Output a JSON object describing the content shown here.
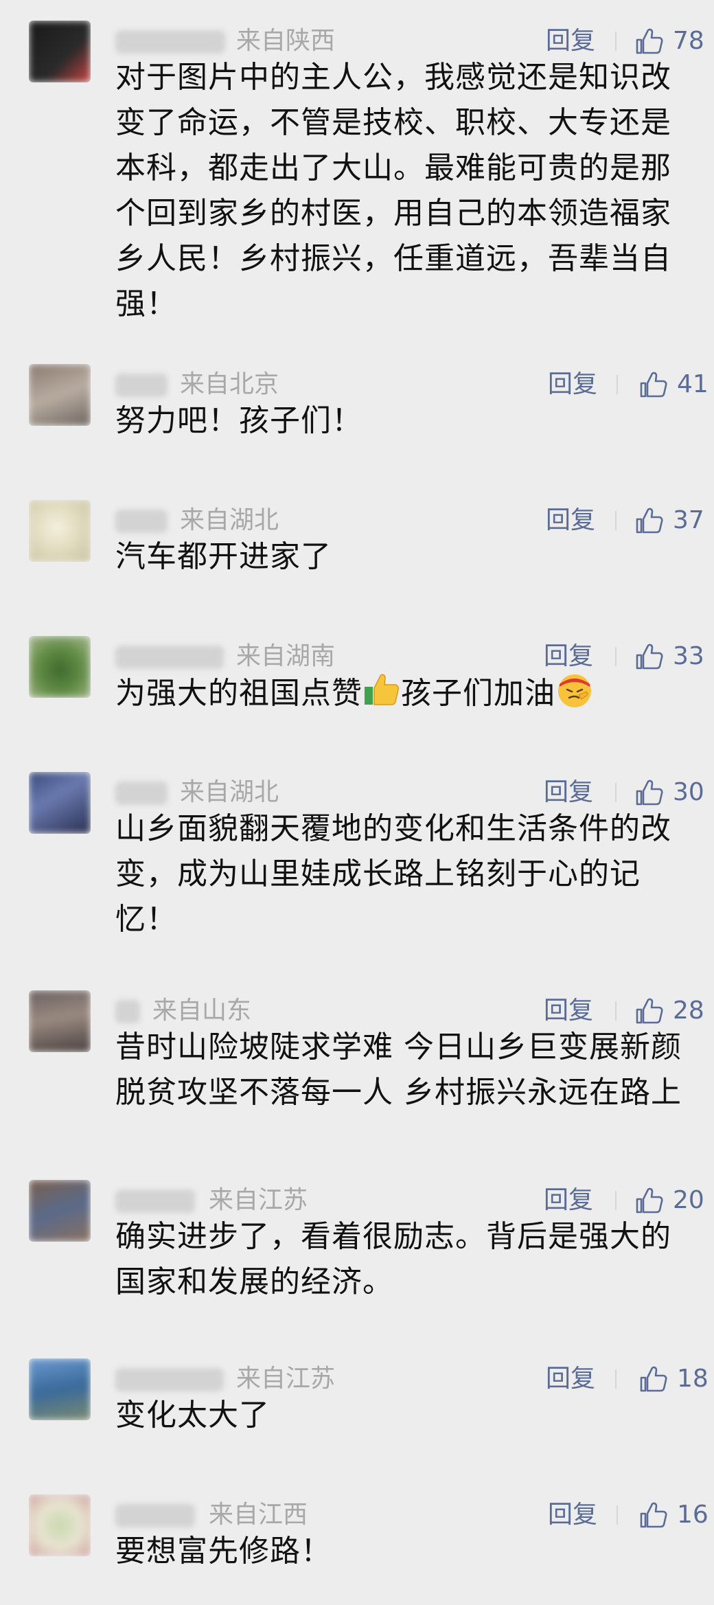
{
  "ui": {
    "reply_label": "回复",
    "accent_color": "#5a6b95",
    "region_color": "#a8a8a8"
  },
  "comments": [
    {
      "region": "来自陕西",
      "likes": "78",
      "text": "对于图片中的主人公，我感觉还是知识改变了命运，不管是技校、职校、大专还是本科，都走出了大山。最难能可贵的是那个回到家乡的村医，用自己的本领造福家乡人民！乡村振兴，任重道远，吾辈当自强！"
    },
    {
      "region": "来自北京",
      "likes": "41",
      "text": "努力吧！孩子们！"
    },
    {
      "region": "来自湖北",
      "likes": "37",
      "text": "汽车都开进家了"
    },
    {
      "region": "来自湖南",
      "likes": "33",
      "text_part1": "为强大的祖国点赞",
      "emoji1": "thumbs-up-emoji",
      "text_part2": "孩子们加油",
      "emoji2": "fighting-emoji"
    },
    {
      "region": "来自湖北",
      "likes": "30",
      "text": "山乡面貌翻天覆地的变化和生活条件的改变，成为山里娃成长路上铭刻于心的记忆！"
    },
    {
      "region": "来自山东",
      "likes": "28",
      "line1": "昔时山险坡陡求学难 今日山乡巨变展新颜",
      "line2": "脱贫攻坚不落每一人 乡村振兴永远在路上"
    },
    {
      "region": "来自江苏",
      "likes": "20",
      "text": "确实进步了，看着很励志。背后是强大的国家和发展的经济。"
    },
    {
      "region": "来自江苏",
      "likes": "18",
      "text": "变化太大了"
    },
    {
      "region": "来自江西",
      "likes": "16",
      "text": "要想富先修路！"
    }
  ]
}
